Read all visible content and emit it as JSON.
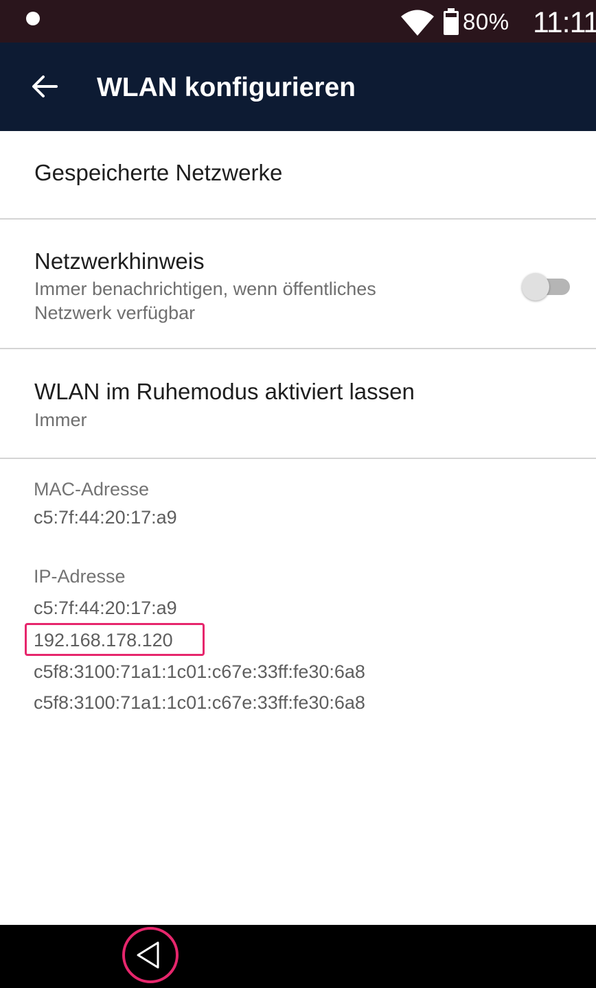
{
  "status_bar": {
    "battery": "80%",
    "time": "11:11"
  },
  "app_bar": {
    "title": "WLAN konfigurieren"
  },
  "settings": {
    "saved_networks": {
      "title": "Gespeicherte Netzwerke"
    },
    "network_notification": {
      "title": "Netzwerkhinweis",
      "subtitle_line1": "Immer benachrichtigen, wenn öffentliches",
      "subtitle_line2": "Netzwerk verfügbar",
      "toggle_on": false
    },
    "wifi_sleep": {
      "title": "WLAN im Ruhemodus aktiviert lassen",
      "subtitle": "Immer"
    }
  },
  "info": {
    "mac_label": "MAC-Adresse",
    "mac_value": "c5:7f:44:20:17:a9",
    "ip_label": "IP-Adresse",
    "ip_values": [
      "c5:7f:44:20:17:a9",
      "192.168.178.120",
      "c5f8:3100:71a1:1c01:c67e:33ff:fe30:6a8",
      "c5f8:3100:71a1:1c01:c67e:33ff:fe30:6a8"
    ]
  },
  "colors": {
    "app_bar": "#0d1b33",
    "status_bar": "#2a151c",
    "highlight": "#e6266c"
  },
  "icons": {
    "status": [
      "notification-dot-icon",
      "wifi-icon",
      "battery-icon"
    ],
    "app_bar": "arrow-left-icon",
    "nav": "triangle-back-icon"
  }
}
